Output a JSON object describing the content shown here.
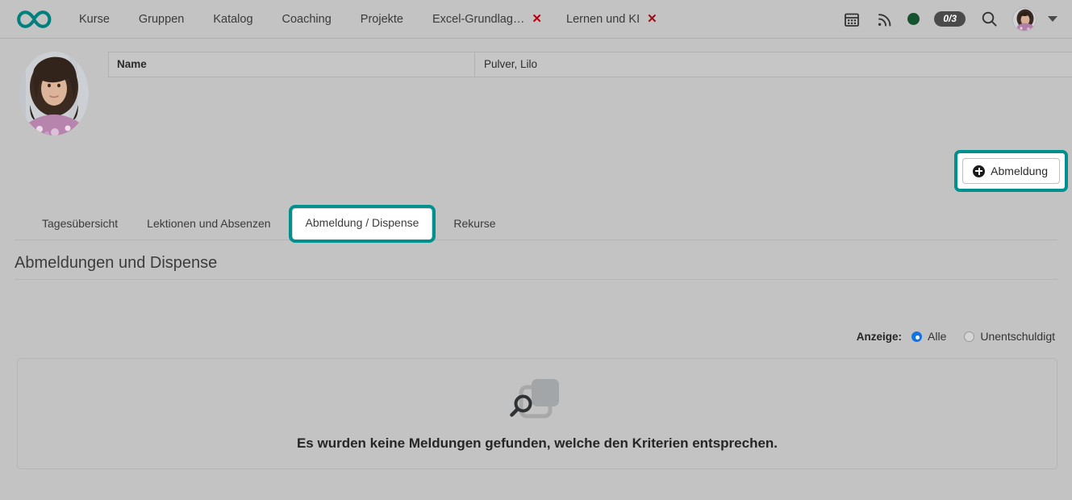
{
  "topnav": {
    "logo_icon": "infinity-logo",
    "brand_color": "#00807d",
    "items": [
      {
        "label": "Kurse"
      },
      {
        "label": "Gruppen"
      },
      {
        "label": "Katalog"
      },
      {
        "label": "Coaching"
      },
      {
        "label": "Projekte"
      }
    ],
    "tabs": [
      {
        "label": "Excel-Grundlag…",
        "close": "✕"
      },
      {
        "label": "Lernen und KI",
        "close": "✕"
      }
    ],
    "right": {
      "calendar_icon": "calendar-icon",
      "feed_icon": "rss-feed-icon",
      "status_dot": "green-status-dot",
      "status_dot_color": "#14532d",
      "count_badge": "0/3",
      "search_icon": "search-icon",
      "avatar": "user-avatar",
      "caret": "chevron-down-icon"
    }
  },
  "person": {
    "avatar": "person-portrait",
    "table": {
      "key": "Name",
      "value": "Pulver, Lilo"
    }
  },
  "actions": {
    "abmeldung_label": "Abmeldung",
    "abmeldung_icon": "plus-circle-icon",
    "highlight_color": "#00918e"
  },
  "tabs": [
    {
      "label": "Tagesübersicht",
      "active": false
    },
    {
      "label": "Lektionen und Absenzen",
      "active": false
    },
    {
      "label": "Abmeldung / Dispense",
      "active": true
    },
    {
      "label": "Rekurse",
      "active": false
    }
  ],
  "section": {
    "title": "Abmeldungen und Dispense"
  },
  "filter": {
    "label": "Anzeige:",
    "options": [
      {
        "label": "Alle",
        "selected": true
      },
      {
        "label": "Unentschuldigt",
        "selected": false
      }
    ],
    "selected_color": "#1273e6"
  },
  "empty_state": {
    "icon": "no-results-search-icon",
    "message": "Es wurden keine Meldungen gefunden, welche den Kriterien entsprechen."
  }
}
